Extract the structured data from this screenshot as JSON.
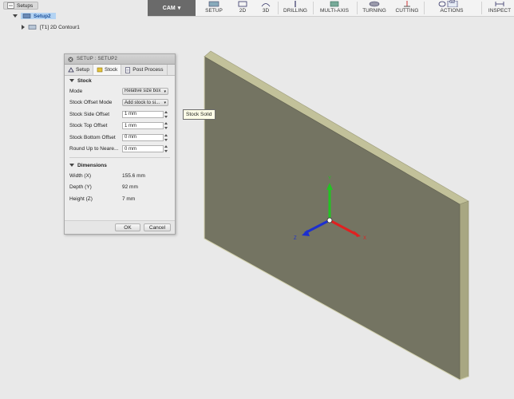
{
  "toolbar": {
    "workspace_label": "CAM",
    "groups": [
      {
        "label": "SETUP"
      },
      {
        "label": "2D"
      },
      {
        "label": "3D"
      },
      {
        "label": "DRILLING"
      },
      {
        "label": "MULTI-AXIS"
      },
      {
        "label": "TURNING"
      },
      {
        "label": "CUTTING"
      },
      {
        "label": "ACTIONS"
      },
      {
        "label": "INSPECT"
      }
    ],
    "actions_badge": "G2"
  },
  "browser": {
    "root": "Setups",
    "setup": "Setup2",
    "operation": "[T1] 2D Contour1"
  },
  "dialog": {
    "title": "SETUP : SETUP2",
    "tabs": [
      "Setup",
      "Stock",
      "Post Process"
    ],
    "stock_section": "Stock",
    "rows": [
      {
        "label": "Mode",
        "value": "Relative size box"
      },
      {
        "label": "Stock Offset Mode",
        "value": "Add stock to si..."
      },
      {
        "label": "Stock Side Offset",
        "value": "1 mm"
      },
      {
        "label": "Stock Top Offset",
        "value": "1 mm"
      },
      {
        "label": "Stock Bottom Offset",
        "value": "0 mm"
      },
      {
        "label": "Round Up to Neare...",
        "value": "0 mm"
      }
    ],
    "dimensions_section": "Dimensions",
    "dimensions": [
      {
        "label": "Width (X)",
        "value": "155.6 mm"
      },
      {
        "label": "Depth (Y)",
        "value": "92 mm"
      },
      {
        "label": "Height (Z)",
        "value": "7 mm"
      }
    ],
    "ok_label": "OK",
    "cancel_label": "Cancel"
  },
  "tooltip": "Stock Solid",
  "axes": {
    "x": "X",
    "y": "Y",
    "z": "Z"
  },
  "colors": {
    "x_axis": "#e02020",
    "y_axis": "#22c322",
    "z_axis": "#1c2fd0",
    "stock_face": "#747462",
    "stock_edge": "#c9c8a0"
  }
}
